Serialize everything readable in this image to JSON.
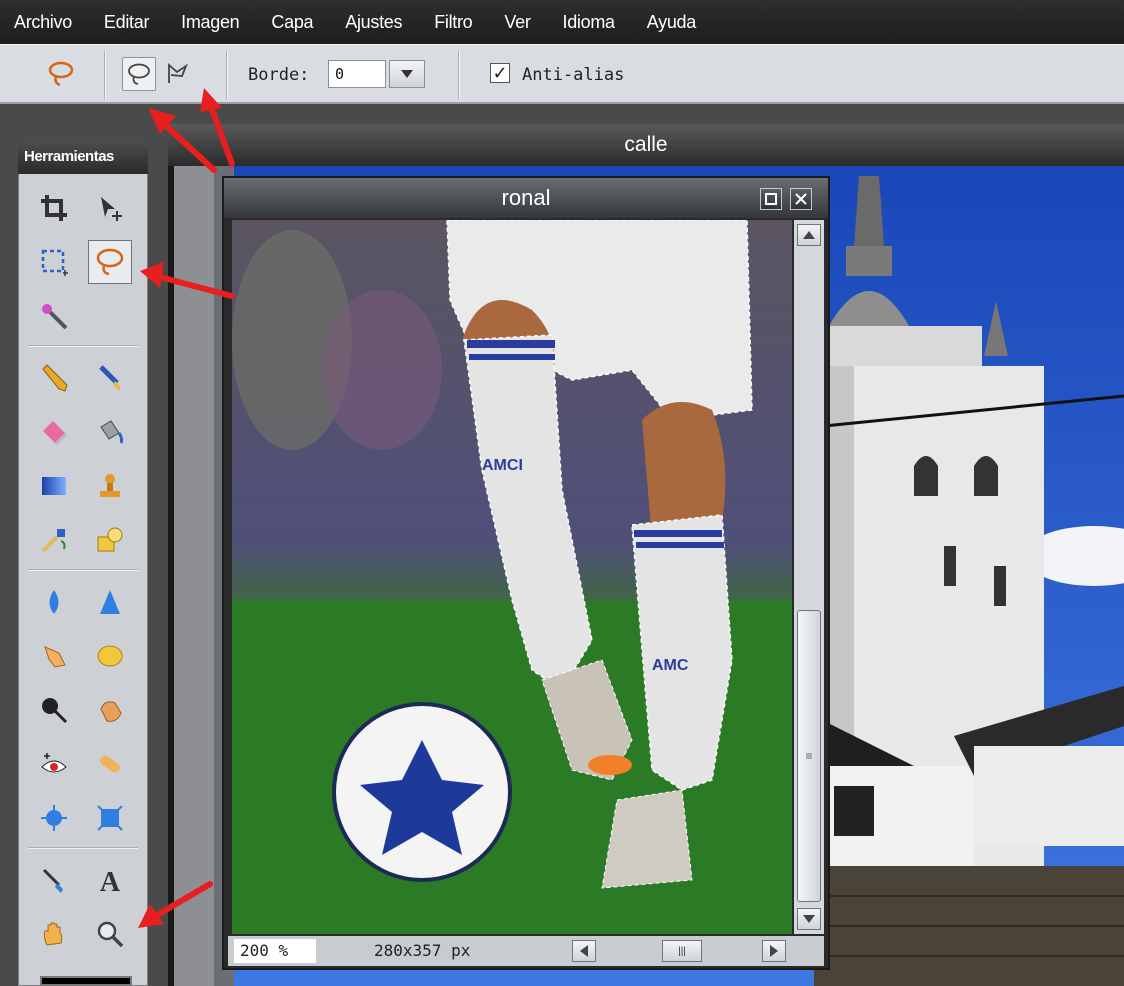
{
  "menu": [
    "Archivo",
    "Editar",
    "Imagen",
    "Capa",
    "Ajustes",
    "Filtro",
    "Ver",
    "Idioma",
    "Ayuda"
  ],
  "options": {
    "border_label": "Borde:",
    "border_value": "0",
    "antialias_label": "Anti-alias",
    "antialias_checked": true
  },
  "tools_panel": {
    "title": "Herramientas"
  },
  "windows": {
    "background": {
      "title": "calle"
    },
    "front": {
      "title": "ronal",
      "zoom": "200 %",
      "dimensions": "280x357 px"
    }
  },
  "colors": {
    "accent_selection": "#d4661a",
    "annotation_arrow": "#e81f1f"
  }
}
